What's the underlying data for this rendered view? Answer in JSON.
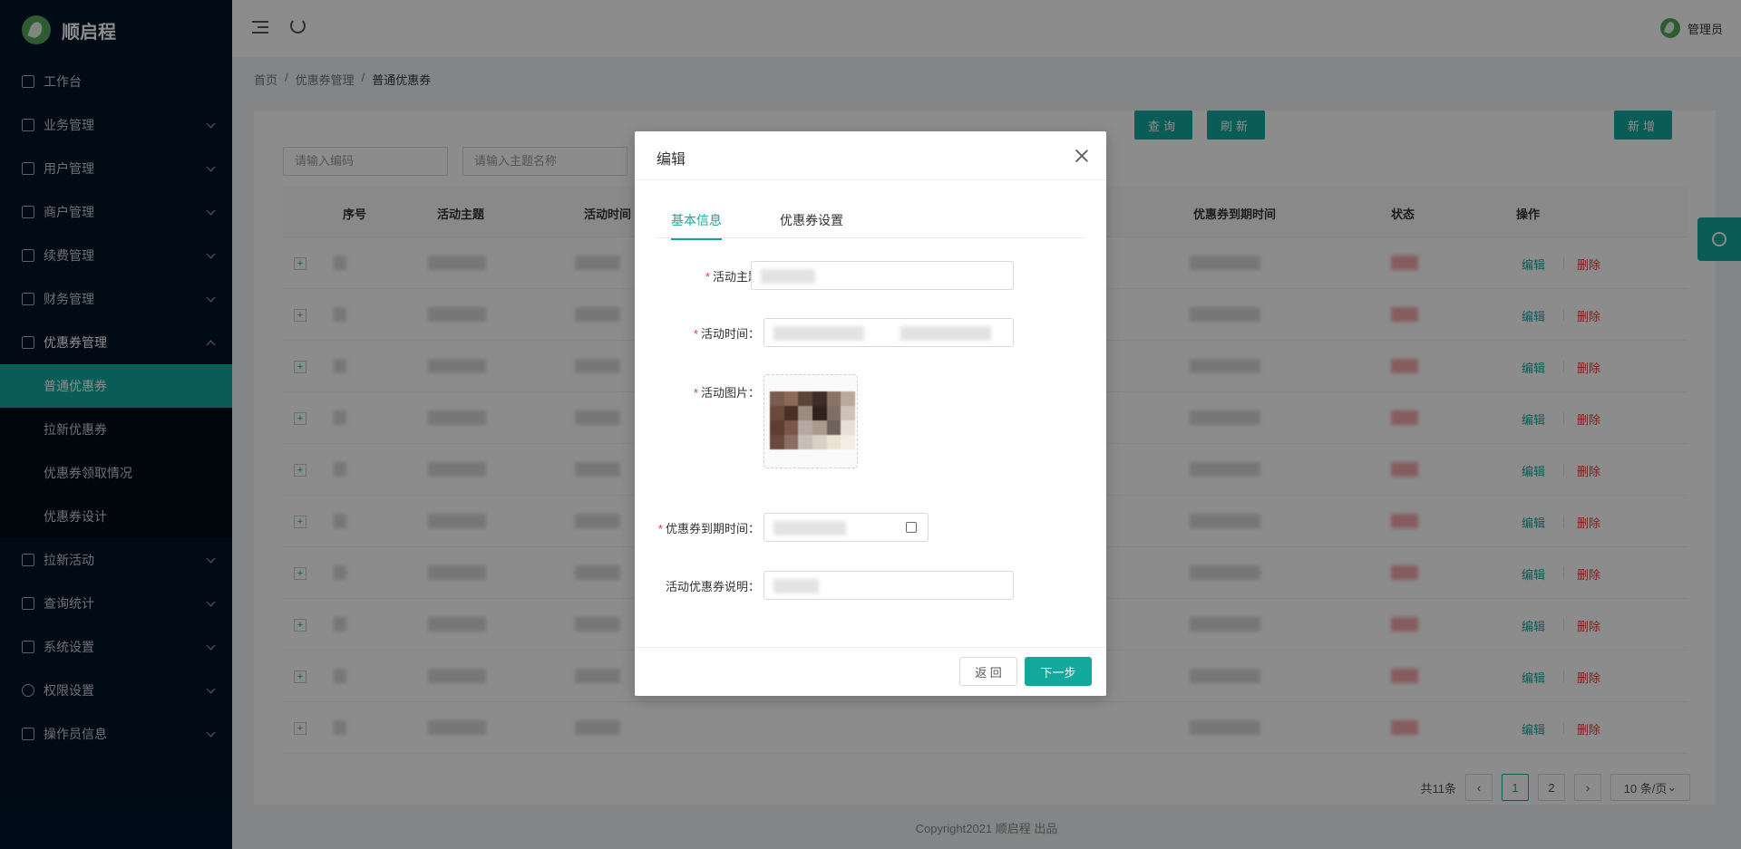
{
  "app": {
    "brand": "顺启程"
  },
  "header": {
    "user_label": "管理员"
  },
  "sidebar": {
    "items": [
      {
        "label": "工作台",
        "icon": "workbench-icon"
      },
      {
        "label": "业务管理",
        "icon": "business-icon"
      },
      {
        "label": "用户管理",
        "icon": "user-icon"
      },
      {
        "label": "商户管理",
        "icon": "merchant-icon"
      },
      {
        "label": "续费管理",
        "icon": "renewal-icon"
      },
      {
        "label": "财务管理",
        "icon": "finance-icon"
      },
      {
        "label": "优惠券管理",
        "icon": "coupon-icon"
      }
    ],
    "sub_items": [
      {
        "label": "普通优惠券"
      },
      {
        "label": "拉新优惠券"
      },
      {
        "label": "优惠券领取情况"
      },
      {
        "label": "优惠券设计"
      }
    ],
    "items_after": [
      {
        "label": "拉新活动",
        "icon": "thumb-up-icon"
      },
      {
        "label": "查询统计",
        "icon": "stats-icon"
      },
      {
        "label": "系统设置",
        "icon": "settings-icon"
      },
      {
        "label": "权限设置",
        "icon": "gear-icon"
      },
      {
        "label": "操作员信息",
        "icon": "operator-icon"
      }
    ]
  },
  "breadcrumb": {
    "home": "首页",
    "parent": "优惠券管理",
    "current": "普通优惠券",
    "sep": "/"
  },
  "search": {
    "code_placeholder": "请输入编码",
    "topic_placeholder": "请输入主题名称",
    "query_label": "查询",
    "refresh_label": "刷新",
    "add_label": "新增"
  },
  "table": {
    "columns": {
      "index": "序号",
      "topic": "活动主题",
      "time": "活动时间",
      "expire": "优惠券到期时间",
      "status": "状态",
      "actions": "操作"
    },
    "row_count": 10,
    "edit_label": "编辑",
    "delete_label": "删除"
  },
  "pagination": {
    "total": "共11条",
    "pages": [
      "1",
      "2"
    ],
    "current_page": "1",
    "page_size": "10 条/页"
  },
  "footer": {
    "copyright": "Copyright2021 顺启程 出品"
  },
  "modal": {
    "title": "编辑",
    "tabs": [
      "基本信息",
      "优惠券设置"
    ],
    "active_tab": "基本信息",
    "fields": {
      "topic_label": "活动主题",
      "time_label": "活动时间",
      "image_label": "活动图片",
      "expire_label": "优惠券到期时间",
      "desc_label": "活动优惠券说明",
      "colon": "："
    },
    "back_label": "返 回",
    "next_label": "下一步"
  },
  "colors": {
    "accent": "#13a89e",
    "sidebar_bg": "#001529",
    "danger": "#e53935",
    "overlay": "rgba(0,0,0,0.45)"
  }
}
